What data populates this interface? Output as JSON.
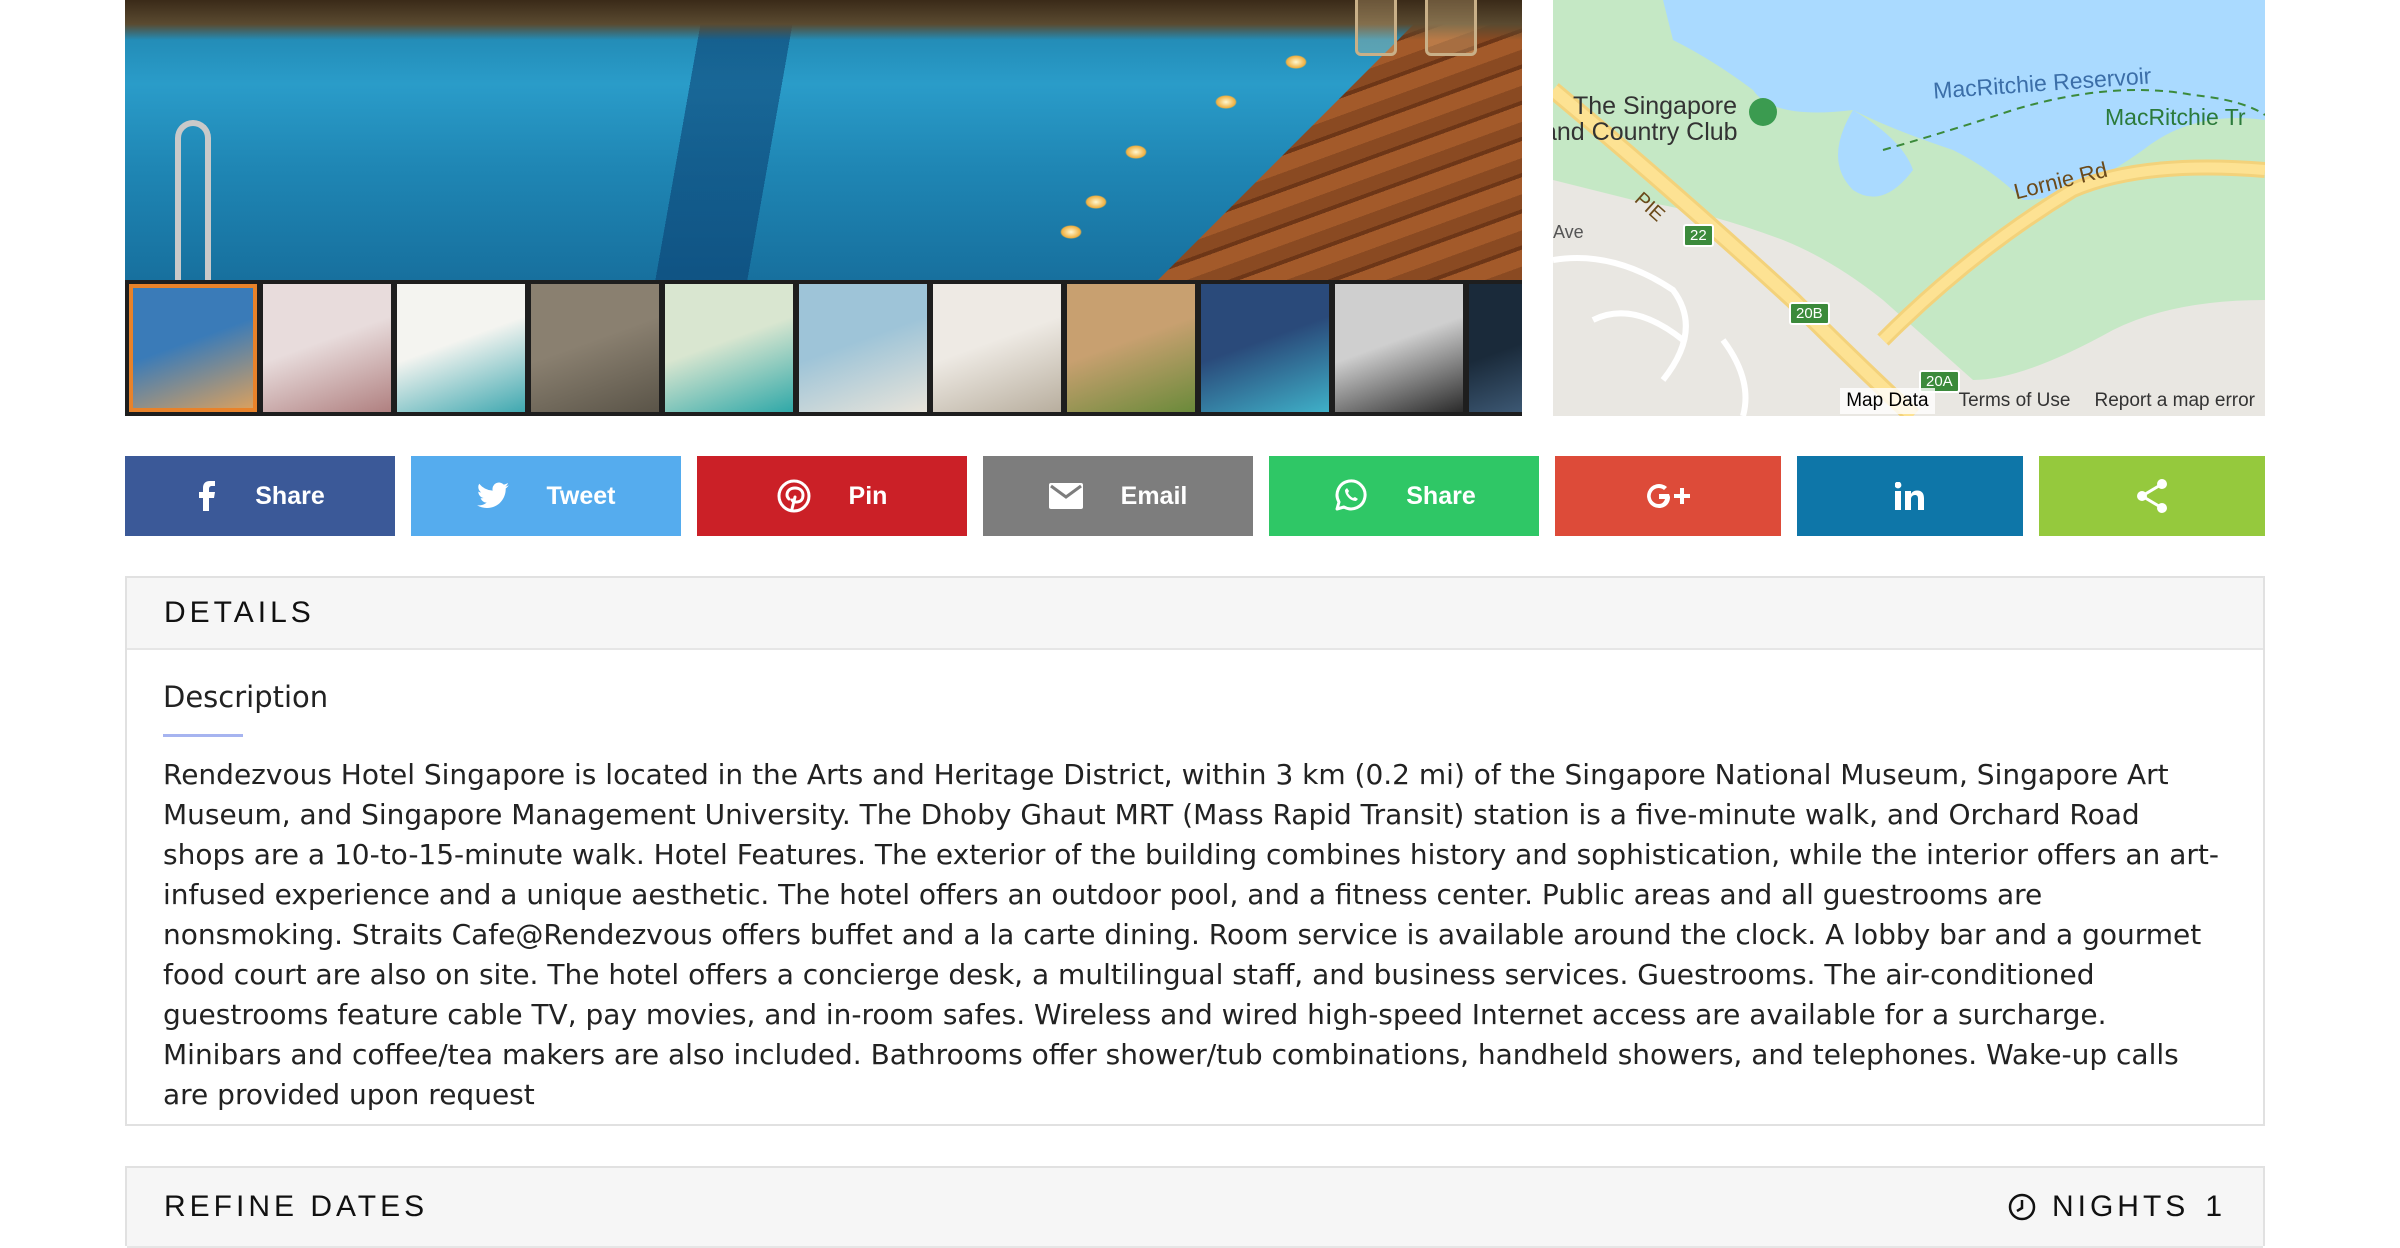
{
  "map": {
    "labels": {
      "country_club_line1": "The Singapore",
      "country_club_line2": "and Country Club",
      "reservoir": "MacRitchie Reservoir",
      "trail": "MacRitchie Tr",
      "road": "Lornie Rd",
      "highway": "PIE",
      "avenue": "Ave",
      "exit_22": "22",
      "exit_20b": "20B",
      "exit_20a": "20A"
    },
    "footer": {
      "map_data": "Map Data",
      "terms": "Terms of Use",
      "report": "Report a map error"
    },
    "colors": {
      "water": "#aadaff",
      "park": "#c5e8c5",
      "land": "#e9e7e2",
      "highway": "#fde293"
    }
  },
  "gallery": {
    "thumbnails": [
      {
        "name": "pool-resort",
        "colors": [
          "#3a7bb8",
          "#d8a060"
        ]
      },
      {
        "name": "suite-interior",
        "colors": [
          "#e8dcdc",
          "#b08080"
        ]
      },
      {
        "name": "poolside-cabana",
        "colors": [
          "#f4f4f0",
          "#3fa8b0"
        ]
      },
      {
        "name": "stone-arch",
        "colors": [
          "#8a8070",
          "#5a5448"
        ]
      },
      {
        "name": "spa-towels",
        "colors": [
          "#d9e6d0",
          "#2fa8a8"
        ]
      },
      {
        "name": "beach-palms",
        "colors": [
          "#9ec4d8",
          "#e8e4da"
        ]
      },
      {
        "name": "white-bedroom",
        "colors": [
          "#eeeae4",
          "#b8ae9e"
        ]
      },
      {
        "name": "buffet",
        "colors": [
          "#c8a070",
          "#6a8a3a"
        ]
      },
      {
        "name": "hotel-night",
        "colors": [
          "#2a4a7a",
          "#3fb0c8"
        ]
      },
      {
        "name": "lounge",
        "colors": [
          "#cfcfcf",
          "#2a2a2a"
        ]
      },
      {
        "name": "dark-room",
        "colors": [
          "#1a2a3a",
          "#4a6a8a"
        ]
      }
    ]
  },
  "share": {
    "buttons": [
      {
        "id": "facebook",
        "label": "Share",
        "icon": "facebook-icon",
        "color": "#3b5998"
      },
      {
        "id": "twitter",
        "label": "Tweet",
        "icon": "twitter-icon",
        "color": "#55acee"
      },
      {
        "id": "pinterest",
        "label": "Pin",
        "icon": "pinterest-icon",
        "color": "#cb2027"
      },
      {
        "id": "email",
        "label": "Email",
        "icon": "email-icon",
        "color": "#7d7d7d"
      },
      {
        "id": "whatsapp",
        "label": "Share",
        "icon": "whatsapp-icon",
        "color": "#2fc766"
      },
      {
        "id": "googleplus",
        "label": "",
        "icon": "google-plus-icon",
        "color": "#dd4b39"
      },
      {
        "id": "linkedin",
        "label": "",
        "icon": "linkedin-icon",
        "color": "#0e76a8"
      },
      {
        "id": "more",
        "label": "",
        "icon": "share-icon",
        "color": "#95c93d"
      }
    ]
  },
  "details": {
    "heading": "DETAILS",
    "description_title": "Description",
    "description": "Rendezvous Hotel Singapore is located in the Arts and Heritage District, within 3 km (0.2 mi) of the Singapore National Museum, Singapore Art Museum, and Singapore Management University. The Dhoby Ghaut MRT (Mass Rapid Transit) station is a five-minute walk, and Orchard Road shops are a 10-to-15-minute walk. Hotel Features. The exterior of the building combines history and sophistication, while the interior offers an art-infused experience and a unique aesthetic. The hotel offers an outdoor pool, and a fitness center. Public areas and all guestrooms are nonsmoking. Straits Cafe@Rendezvous offers buffet and a la carte dining. Room service is available around the clock. A lobby bar and a gourmet food court are also on site. The hotel offers a concierge desk, a multilingual staff, and business services. Guestrooms. The air-conditioned guestrooms feature cable TV, pay movies, and in-room safes. Wireless and wired high-speed Internet access are available for a surcharge. Minibars and coffee/tea makers are also included. Bathrooms offer shower/tub combinations, handheld showers, and telephones. Wake-up calls are provided upon request",
    "accent_color": "#a6b4f0"
  },
  "refine": {
    "heading": "REFINE DATES",
    "nights_label": "NIGHTS",
    "nights_value": "1"
  }
}
